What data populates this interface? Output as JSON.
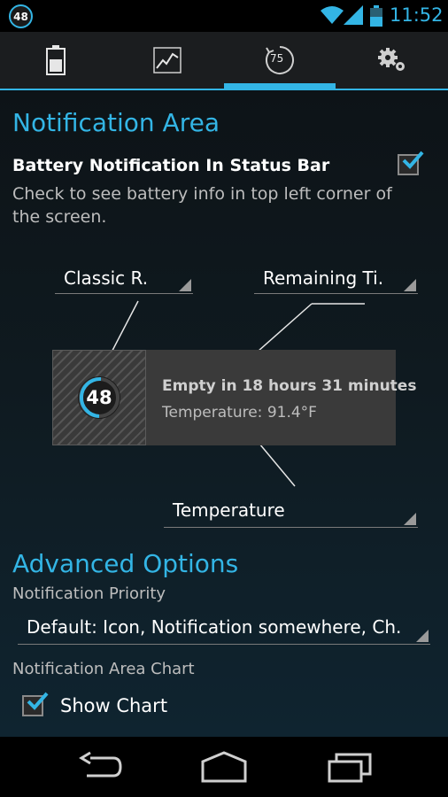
{
  "status_bar": {
    "battery_badge": "48",
    "time": "11:52",
    "icons": [
      "battery-level-badge-icon",
      "wifi-icon",
      "cell-signal-icon",
      "battery-icon"
    ]
  },
  "tabs": [
    {
      "name": "battery",
      "icon": "battery-icon"
    },
    {
      "name": "history",
      "icon": "chart-icon"
    },
    {
      "name": "notification",
      "icon": "gauge-icon",
      "label": "75",
      "selected": true
    },
    {
      "name": "settings",
      "icon": "gears-icon"
    }
  ],
  "notification_area": {
    "title": "Notification Area",
    "battery_pref": {
      "title": "Battery Notification In Status Bar",
      "summary": "Check to see battery info in top left corner of the screen.",
      "checked": true
    },
    "icon_style_spinner": "Classic R.",
    "line1_spinner": "Remaining Ti.",
    "line2_spinner": "Temperature",
    "preview": {
      "badge": "48",
      "line1": "Empty in 18 hours 31 minutes",
      "line2": "Temperature: 91.4°F"
    }
  },
  "advanced_options": {
    "title": "Advanced Options",
    "priority_label": "Notification Priority",
    "priority_value": "Default: Icon, Notification somewhere, Ch.",
    "chart_label": "Notification Area Chart",
    "show_chart_label": "Show Chart",
    "show_chart_checked": true
  },
  "colors": {
    "accent": "#33b5e5",
    "background": "#0e1418",
    "text": "#ffffff"
  },
  "nav_bar": [
    "back-icon",
    "home-icon",
    "recents-icon"
  ]
}
